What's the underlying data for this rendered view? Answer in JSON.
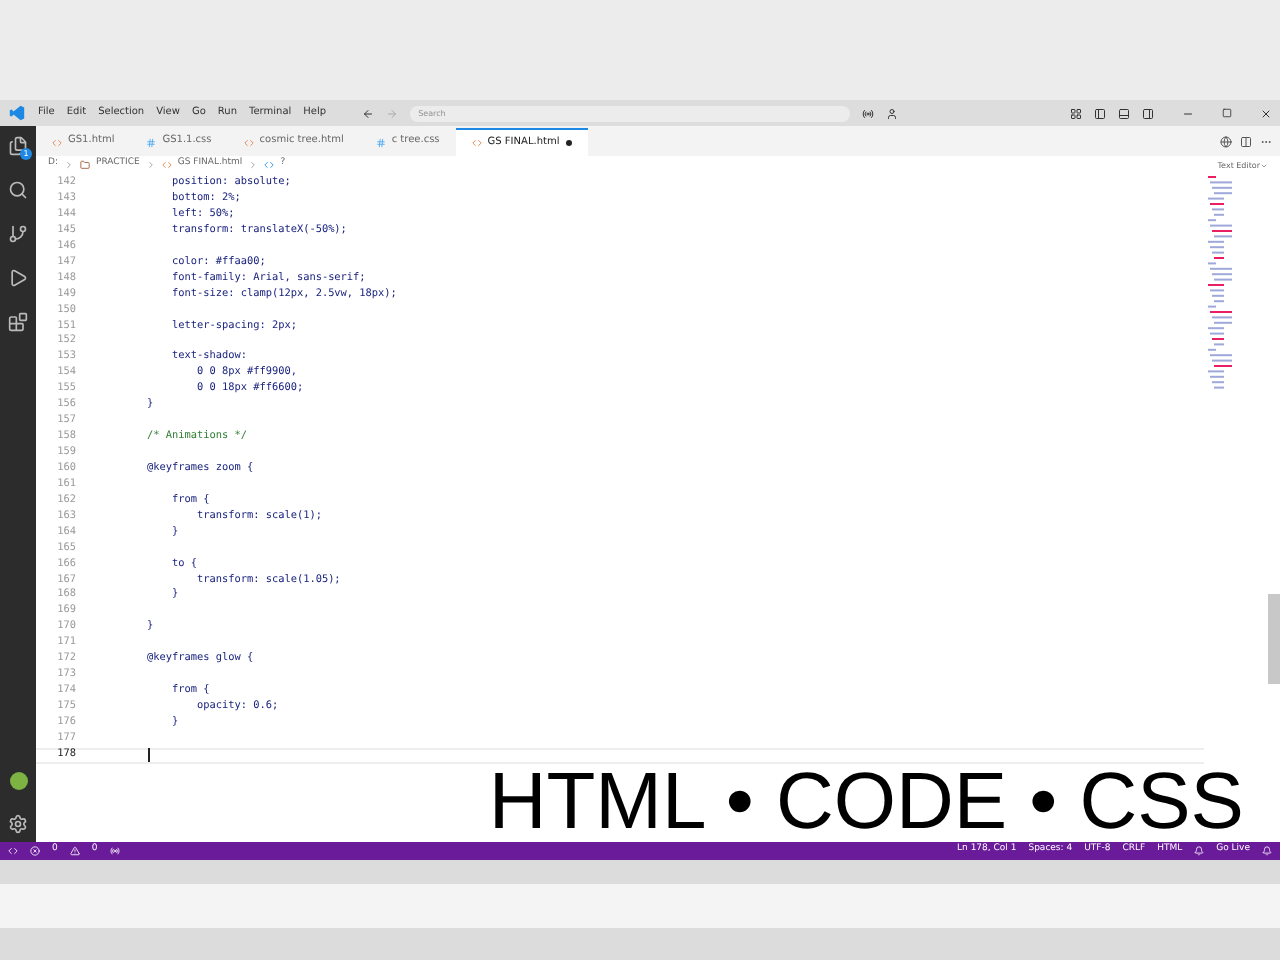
{
  "menu": [
    "File",
    "Edit",
    "Selection",
    "View",
    "Go",
    "Run",
    "Terminal",
    "Help"
  ],
  "search": {
    "placeholder": "Search"
  },
  "tabs": [
    {
      "label": "GS1.html",
      "kind": "html",
      "selected": false,
      "modified": false
    },
    {
      "label": "GS1.1.css",
      "kind": "css",
      "selected": false,
      "modified": false
    },
    {
      "label": "cosmic tree.html",
      "kind": "html",
      "selected": false,
      "modified": false
    },
    {
      "label": "c tree.css",
      "kind": "css",
      "selected": false,
      "modified": false
    },
    {
      "label": "GS FINAL.html",
      "kind": "html",
      "selected": true,
      "modified": true
    }
  ],
  "breadcrumb": [
    "D:",
    "PRACTICE",
    "GS FINAL.html",
    "?"
  ],
  "editor_mode": "Text Editor",
  "explorer_badge": "1",
  "lines": [
    {
      "number": "142",
      "text": "        position: absolute;",
      "kind": "code",
      "current": false
    },
    {
      "number": "143",
      "text": "        bottom: 2%;",
      "kind": "code",
      "current": false
    },
    {
      "number": "144",
      "text": "        left: 50%;",
      "kind": "code",
      "current": false
    },
    {
      "number": "145",
      "text": "        transform: translateX(-50%);",
      "kind": "code",
      "current": false
    },
    {
      "number": "146",
      "current": false
    },
    {
      "number": "147",
      "text": "        color: #ffaa00;",
      "kind": "code",
      "current": false
    },
    {
      "number": "148",
      "text": "        font-family: Arial, sans-serif;",
      "kind": "code",
      "current": false
    },
    {
      "number": "149",
      "text": "        font-size: clamp(12px, 2.5vw, 18px);",
      "kind": "code",
      "current": false
    },
    {
      "number": "150",
      "current": false
    },
    {
      "number": "151",
      "text": "        letter-spacing: 2px;",
      "kind": "code",
      "current": false
    },
    {
      "number": "152",
      "current": false
    },
    {
      "number": "153",
      "text": "        text-shadow:",
      "kind": "code",
      "current": false
    },
    {
      "number": "154",
      "text": "            0 0 8px #ff9900,",
      "kind": "code",
      "current": false
    },
    {
      "number": "155",
      "text": "            0 0 18px #ff6600;",
      "kind": "code",
      "current": false
    },
    {
      "number": "156",
      "text": "    }",
      "kind": "code",
      "current": false
    },
    {
      "number": "157",
      "current": false
    },
    {
      "number": "158",
      "text": "    /* Animations */",
      "kind": "comment",
      "current": false
    },
    {
      "number": "159",
      "current": false
    },
    {
      "number": "160",
      "text": "    @keyframes zoom {",
      "kind": "code",
      "current": false
    },
    {
      "number": "161",
      "current": false
    },
    {
      "number": "162",
      "text": "        from {",
      "kind": "code",
      "current": false
    },
    {
      "number": "163",
      "text": "            transform: scale(1);",
      "kind": "code",
      "current": false
    },
    {
      "number": "164",
      "text": "        }",
      "kind": "code",
      "current": false
    },
    {
      "number": "165",
      "current": false
    },
    {
      "number": "166",
      "text": "        to {",
      "kind": "code",
      "current": false
    },
    {
      "number": "167",
      "text": "            transform: scale(1.05);",
      "kind": "code",
      "current": false
    },
    {
      "number": "168",
      "text": "        }",
      "kind": "code",
      "current": false
    },
    {
      "number": "169",
      "current": false
    },
    {
      "number": "170",
      "text": "    }",
      "kind": "code",
      "current": false
    },
    {
      "number": "171",
      "current": false
    },
    {
      "number": "172",
      "text": "    @keyframes glow {",
      "kind": "code",
      "current": false
    },
    {
      "number": "173",
      "current": false
    },
    {
      "number": "174",
      "text": "        from {",
      "kind": "code",
      "current": false
    },
    {
      "number": "175",
      "text": "            opacity: 0.6;",
      "kind": "code",
      "current": false
    },
    {
      "number": "176",
      "text": "        }",
      "kind": "code",
      "current": false
    },
    {
      "number": "177",
      "current": false
    },
    {
      "number": "178",
      "current": true
    }
  ],
  "status_bar": {
    "errors": "0",
    "warnings": "0",
    "position": "Ln 178, Col 1",
    "spaces": "Spaces: 4",
    "encoding": "UTF-8",
    "eol": "CRLF",
    "language": "HTML",
    "live": "Go Live"
  },
  "overlay_caption": "HTML • CODE • CSS"
}
